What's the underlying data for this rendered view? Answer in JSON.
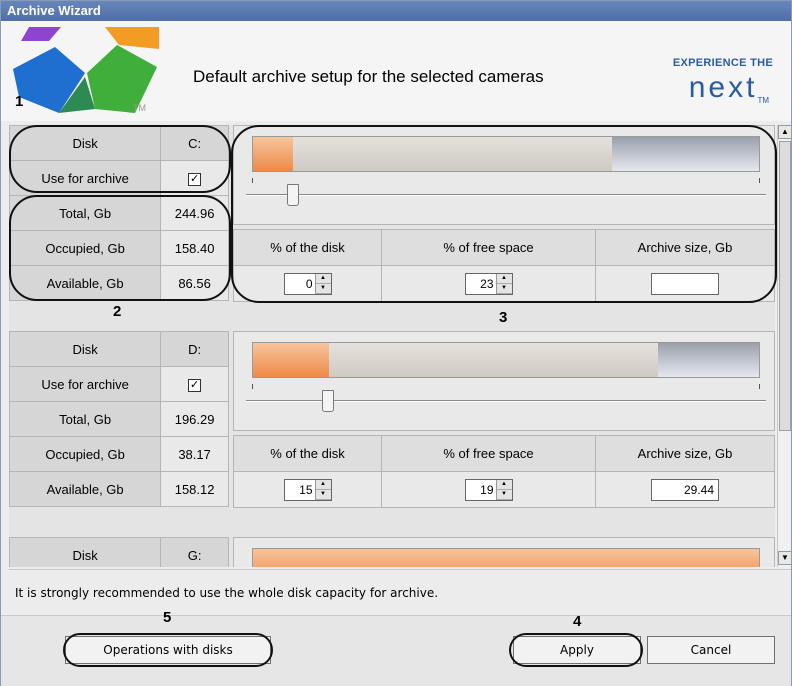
{
  "window": {
    "title": "Archive Wizard"
  },
  "header": {
    "title": "Default archive setup for the selected cameras",
    "brand_top": "EXPERIENCE THE",
    "brand_name": "next",
    "brand_tm": "TM",
    "logo_tm": "TM"
  },
  "labels": {
    "disk": "Disk",
    "use_for_archive": "Use for archive",
    "total": "Total, Gb",
    "occupied": "Occupied, Gb",
    "available": "Available, Gb",
    "pct_disk": "% of the disk",
    "pct_free": "% of free space",
    "archive_size": "Archive size, Gb"
  },
  "disks": [
    {
      "drive": "C:",
      "use_for_archive": true,
      "total": "244.96",
      "occupied": "158.40",
      "available": "86.56",
      "pct_disk": "0",
      "pct_free": "23",
      "archive_size": "",
      "bar_occupied_pct": 71,
      "bar_archive_pct": 8,
      "slider_pct": 8
    },
    {
      "drive": "D:",
      "use_for_archive": true,
      "total": "196.29",
      "occupied": "38.17",
      "available": "158.12",
      "pct_disk": "15",
      "pct_free": "19",
      "archive_size": "29.44",
      "bar_occupied_pct": 80,
      "bar_archive_pct": 15,
      "slider_pct": 15
    },
    {
      "drive": "G:",
      "bar_occupied_pct": 0,
      "bar_archive_pct": 100
    }
  ],
  "info": {
    "text": "It is strongly recommended to use the whole disk capacity for archive."
  },
  "buttons": {
    "operations": "Operations with disks",
    "apply": "Apply",
    "cancel": "Cancel"
  },
  "annotations": {
    "n1": "1",
    "n2": "2",
    "n3": "3",
    "n4": "4",
    "n5": "5"
  },
  "icons": {
    "checkbox_checked": "check-mark",
    "spin_up": "arrow-up",
    "spin_down": "arrow-down",
    "scroll_up": "arrow-up",
    "scroll_down": "arrow-down"
  }
}
